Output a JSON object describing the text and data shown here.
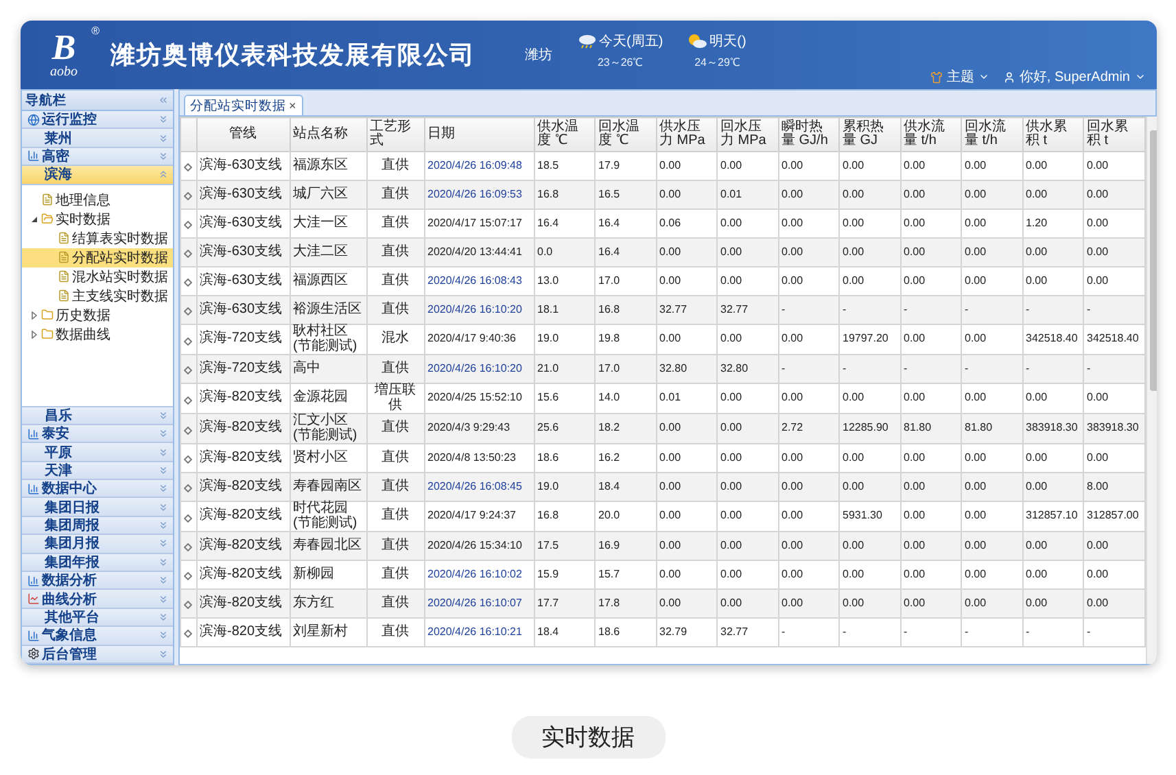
{
  "header": {
    "logo": {
      "letter": "B",
      "sub": "aobo",
      "mark": "®"
    },
    "company": "潍坊奥博仪表科技发展有限公司",
    "city": "潍坊",
    "weather": [
      {
        "kind": "rain",
        "label": "今天(周五)",
        "temp": "23～26℃"
      },
      {
        "kind": "sun",
        "label": "明天()",
        "temp": "24～29℃"
      }
    ],
    "theme_menu": "主题",
    "user_menu": "你好, SuperAdmin"
  },
  "sidebar": {
    "title": "导航栏",
    "items": [
      {
        "label": "运行监控",
        "kind": "globe",
        "expanded": false
      },
      {
        "label": "莱州",
        "kind": "plain",
        "expanded": false
      },
      {
        "label": "高密",
        "kind": "chart",
        "expanded": false
      },
      {
        "label": "滨海",
        "kind": "plain",
        "expanded": true,
        "tree": [
          {
            "label": "地理信息",
            "kind": "file",
            "selected": false
          },
          {
            "label": "实时数据",
            "kind": "folder",
            "expanded": true,
            "selected": false,
            "children": [
              {
                "label": "结算表实时数据",
                "kind": "file",
                "selected": false
              },
              {
                "label": "分配站实时数据",
                "kind": "file",
                "selected": true
              },
              {
                "label": "混水站实时数据",
                "kind": "file",
                "selected": false
              },
              {
                "label": "主支线实时数据",
                "kind": "file",
                "selected": false
              }
            ]
          },
          {
            "label": "历史数据",
            "kind": "folder",
            "expanded": false,
            "selected": false
          },
          {
            "label": "数据曲线",
            "kind": "folder",
            "expanded": false,
            "selected": false
          }
        ]
      },
      {
        "label": "昌乐",
        "kind": "plain",
        "expanded": false
      },
      {
        "label": "泰安",
        "kind": "chart",
        "expanded": false
      },
      {
        "label": "平原",
        "kind": "plain",
        "expanded": false
      },
      {
        "label": "天津",
        "kind": "plain",
        "expanded": false
      },
      {
        "label": "数据中心",
        "kind": "chart",
        "expanded": false
      },
      {
        "label": "集团日报",
        "kind": "plain",
        "expanded": false
      },
      {
        "label": "集团周报",
        "kind": "plain",
        "expanded": false
      },
      {
        "label": "集团月报",
        "kind": "plain",
        "expanded": false
      },
      {
        "label": "集团年报",
        "kind": "plain",
        "expanded": false
      },
      {
        "label": "数据分析",
        "kind": "chart",
        "expanded": false
      },
      {
        "label": "曲线分析",
        "kind": "curve",
        "expanded": false
      },
      {
        "label": "其他平台",
        "kind": "plain",
        "expanded": false
      },
      {
        "label": "气象信息",
        "kind": "chart",
        "expanded": false
      },
      {
        "label": "后台管理",
        "kind": "gear",
        "expanded": false
      }
    ]
  },
  "tabs": [
    {
      "label": "分配站实时数据",
      "close": "×",
      "selected": true
    }
  ],
  "table": {
    "columns": [
      "管线",
      "站点名称",
      "工艺形式",
      "日期",
      "供水温度 ℃",
      "回水温度 ℃",
      "供水压力 MPa",
      "回水压力 MPa",
      "瞬时热量 GJ/h",
      "累积热量 GJ",
      "供水流量 t/h",
      "回水流量 t/h",
      "供水累积 t",
      "回水累积 t"
    ],
    "rows": [
      {
        "online": true,
        "cells": [
          "滨海-630支线",
          "福源东区",
          "直供",
          "2020/4/26 16:09:48",
          "18.5",
          "17.9",
          "0.00",
          "0.00",
          "0.00",
          "0.00",
          "0.00",
          "0.00",
          "0.00",
          "0.00"
        ]
      },
      {
        "online": true,
        "cells": [
          "滨海-630支线",
          "城厂六区",
          "直供",
          "2020/4/26 16:09:53",
          "16.8",
          "16.5",
          "0.00",
          "0.01",
          "0.00",
          "0.00",
          "0.00",
          "0.00",
          "0.00",
          "0.00"
        ]
      },
      {
        "online": false,
        "cells": [
          "滨海-630支线",
          "大洼一区",
          "直供",
          "2020/4/17 15:07:17",
          "16.4",
          "16.4",
          "0.06",
          "0.00",
          "0.00",
          "0.00",
          "0.00",
          "0.00",
          "1.20",
          "0.00"
        ]
      },
      {
        "online": false,
        "cells": [
          "滨海-630支线",
          "大洼二区",
          "直供",
          "2020/4/20 13:44:41",
          "0.0",
          "16.4",
          "0.00",
          "0.00",
          "0.00",
          "0.00",
          "0.00",
          "0.00",
          "0.00",
          "0.00"
        ]
      },
      {
        "online": true,
        "cells": [
          "滨海-630支线",
          "福源西区",
          "直供",
          "2020/4/26 16:08:43",
          "13.0",
          "17.0",
          "0.00",
          "0.00",
          "0.00",
          "0.00",
          "0.00",
          "0.00",
          "0.00",
          "0.00"
        ]
      },
      {
        "online": true,
        "cells": [
          "滨海-630支线",
          "裕源生活区",
          "直供",
          "2020/4/26 16:10:20",
          "18.1",
          "16.8",
          "32.77",
          "32.77",
          "-",
          "-",
          "-",
          "-",
          "-",
          "-"
        ]
      },
      {
        "online": false,
        "cells": [
          "滨海-720支线",
          "耿村社区(节能测试)",
          "混水",
          "2020/4/17 9:40:36",
          "19.0",
          "19.8",
          "0.00",
          "0.00",
          "0.00",
          "19797.20",
          "0.00",
          "0.00",
          "342518.40",
          "342518.40"
        ]
      },
      {
        "online": true,
        "cells": [
          "滨海-720支线",
          "高中",
          "直供",
          "2020/4/26 16:10:20",
          "21.0",
          "17.0",
          "32.80",
          "32.80",
          "-",
          "-",
          "-",
          "-",
          "-",
          "-"
        ]
      },
      {
        "online": false,
        "cells": [
          "滨海-820支线",
          "金源花园",
          "増压联供",
          "2020/4/25 15:52:10",
          "15.6",
          "14.0",
          "0.01",
          "0.00",
          "0.00",
          "0.00",
          "0.00",
          "0.00",
          "0.00",
          "0.00"
        ]
      },
      {
        "online": false,
        "cells": [
          "滨海-820支线",
          "汇文小区(节能测试)",
          "直供",
          "2020/4/3 9:29:43",
          "25.6",
          "18.2",
          "0.00",
          "0.00",
          "2.72",
          "12285.90",
          "81.80",
          "81.80",
          "383918.30",
          "383918.30"
        ]
      },
      {
        "online": false,
        "cells": [
          "滨海-820支线",
          "贤村小区",
          "直供",
          "2020/4/8 13:50:23",
          "18.6",
          "16.2",
          "0.00",
          "0.00",
          "0.00",
          "0.00",
          "0.00",
          "0.00",
          "0.00",
          "0.00"
        ]
      },
      {
        "online": true,
        "cells": [
          "滨海-820支线",
          "寿春园南区",
          "直供",
          "2020/4/26 16:08:45",
          "19.0",
          "18.4",
          "0.00",
          "0.00",
          "0.00",
          "0.00",
          "0.00",
          "0.00",
          "0.00",
          "8.00"
        ]
      },
      {
        "online": false,
        "cells": [
          "滨海-820支线",
          "时代花园(节能测试)",
          "直供",
          "2020/4/17 9:24:37",
          "16.8",
          "20.0",
          "0.00",
          "0.00",
          "0.00",
          "5931.30",
          "0.00",
          "0.00",
          "312857.10",
          "312857.00"
        ]
      },
      {
        "online": false,
        "cells": [
          "滨海-820支线",
          "寿春园北区",
          "直供",
          "2020/4/26 15:34:10",
          "17.5",
          "16.9",
          "0.00",
          "0.00",
          "0.00",
          "0.00",
          "0.00",
          "0.00",
          "0.00",
          "0.00"
        ]
      },
      {
        "online": true,
        "cells": [
          "滨海-820支线",
          "新柳园",
          "直供",
          "2020/4/26 16:10:02",
          "15.9",
          "15.7",
          "0.00",
          "0.00",
          "0.00",
          "0.00",
          "0.00",
          "0.00",
          "0.00",
          "0.00"
        ]
      },
      {
        "online": true,
        "cells": [
          "滨海-820支线",
          "东方红",
          "直供",
          "2020/4/26 16:10:07",
          "17.7",
          "17.8",
          "0.00",
          "0.00",
          "0.00",
          "0.00",
          "0.00",
          "0.00",
          "0.00",
          "0.00"
        ]
      },
      {
        "online": true,
        "cells": [
          "滨海-820支线",
          "刘星新村",
          "直供",
          "2020/4/26 16:10:21",
          "18.4",
          "18.6",
          "32.79",
          "32.77",
          "-",
          "-",
          "-",
          "-",
          "-",
          "-"
        ]
      }
    ]
  },
  "caption": "实时数据"
}
